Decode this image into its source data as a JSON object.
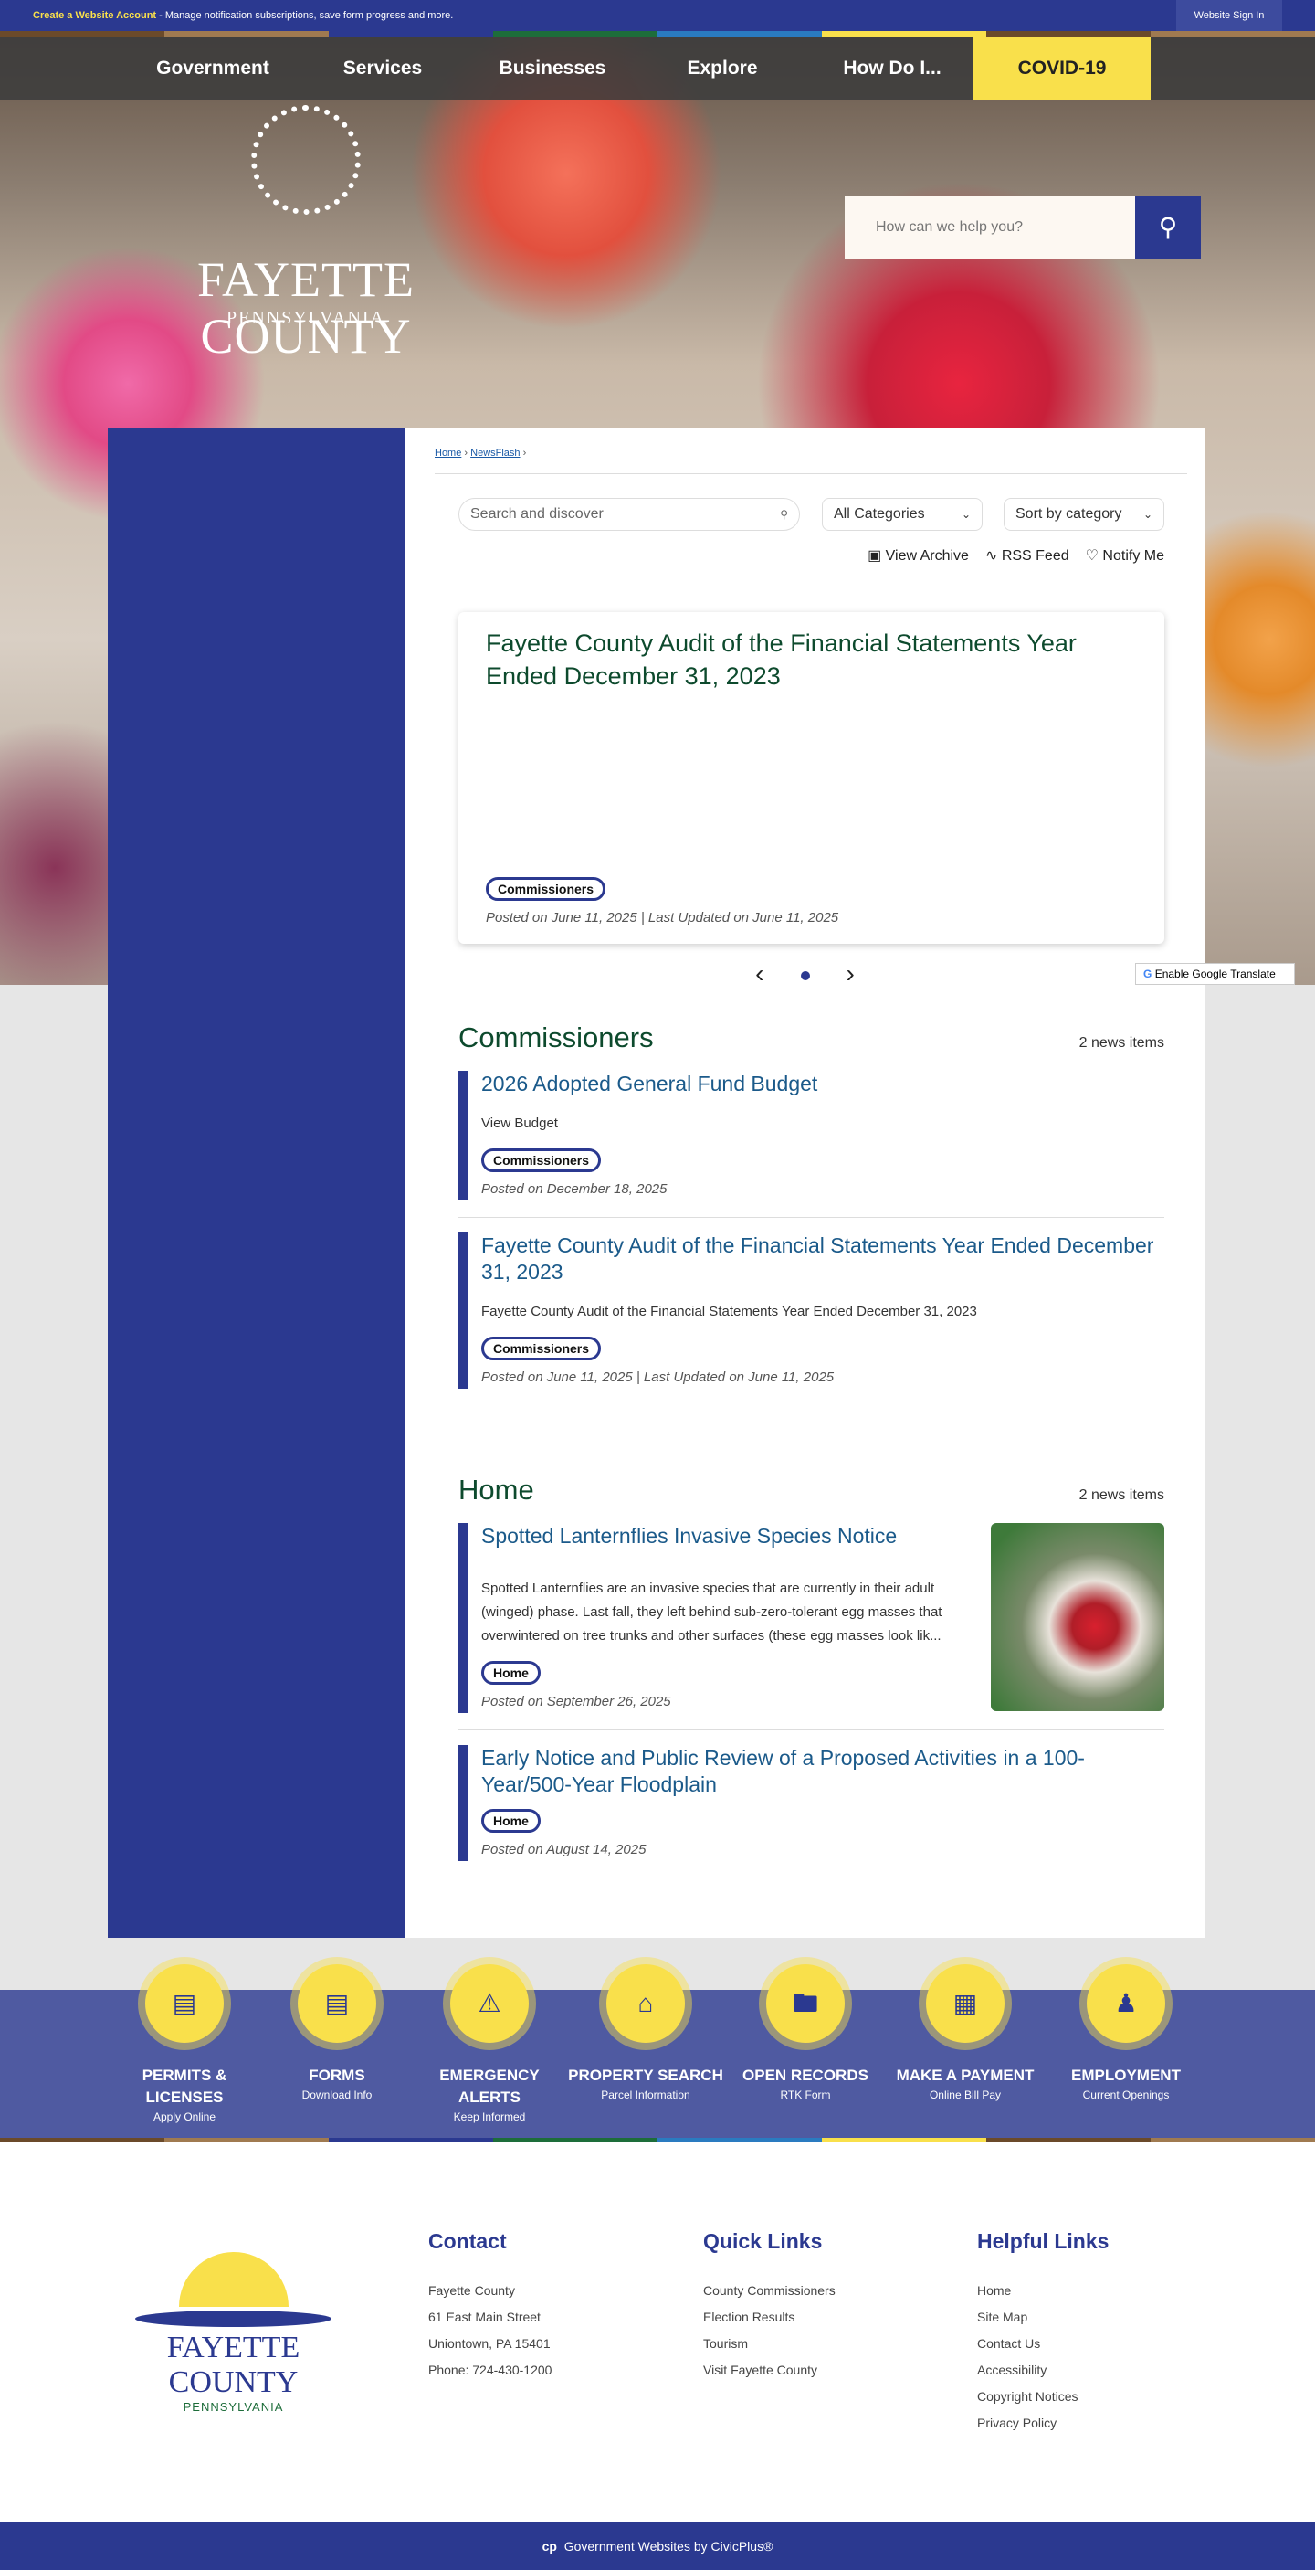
{
  "topbar": {
    "account_link": "Create a Website Account",
    "account_msg": " - Manage notification subscriptions, save form progress and more.",
    "sign_in": "Website Sign In"
  },
  "nav": [
    "Government",
    "Services",
    "Businesses",
    "Explore",
    "How Do I...",
    "COVID-19"
  ],
  "logo": {
    "name": "FAYETTE COUNTY",
    "state": "PENNSYLVANIA"
  },
  "hero_search": {
    "placeholder": "How can we help you?"
  },
  "breadcrumb": {
    "home": "Home",
    "newsflash": "NewsFlash",
    "sep": "›"
  },
  "filters": {
    "search_placeholder": "Search and discover",
    "categories": "All Categories",
    "sort": "Sort by category"
  },
  "actions": {
    "archive": "View Archive",
    "rss": "RSS Feed",
    "notify": "Notify Me"
  },
  "featured": {
    "title": "Fayette County Audit of the Financial Statements Year Ended December 31, 2023",
    "tag": "Commissioners",
    "posted": "Posted on June 11, 2025 | Last Updated on June 11, 2025"
  },
  "translate": "Enable Google Translate",
  "sections": [
    {
      "title": "Commissioners",
      "count": "2 news items",
      "items": [
        {
          "title": "2026 Adopted General Fund Budget",
          "summary": "View Budget",
          "tag": "Commissioners",
          "posted": "Posted on December 18, 2025"
        },
        {
          "title": "Fayette County Audit of the Financial Statements Year Ended December 31, 2023",
          "summary": "Fayette County Audit of the Financial Statements Year Ended December 31, 2023",
          "tag": "Commissioners",
          "posted": "Posted on June 11, 2025 | Last Updated on June 11, 2025"
        }
      ]
    },
    {
      "title": "Home",
      "count": "2 news items",
      "items": [
        {
          "title": "Spotted Lanternflies Invasive Species Notice",
          "summary": "Spotted Lanternflies are an invasive species that are currently in their adult (winged) phase. Last fall, they left behind sub-zero-tolerant egg masses that overwintered on tree trunks and other surfaces (these egg masses look lik...",
          "tag": "Home",
          "posted": "Posted on September 26, 2025"
        },
        {
          "title": "Early Notice and Public Review of a Proposed Activities in a 100-Year/500-Year Floodplain",
          "tag": "Home",
          "posted": "Posted on August 14, 2025"
        }
      ]
    }
  ],
  "quicklinks": [
    {
      "title": "PERMITS & LICENSES",
      "sub": "Apply Online"
    },
    {
      "title": "FORMS",
      "sub": "Download Info"
    },
    {
      "title": "EMERGENCY ALERTS",
      "sub": "Keep Informed"
    },
    {
      "title": "PROPERTY SEARCH",
      "sub": "Parcel Information"
    },
    {
      "title": "OPEN RECORDS",
      "sub": "RTK Form"
    },
    {
      "title": "MAKE A PAYMENT",
      "sub": "Online Bill Pay"
    },
    {
      "title": "EMPLOYMENT",
      "sub": "Current Openings"
    }
  ],
  "footer": {
    "contact": {
      "title": "Contact",
      "lines": [
        "Fayette County",
        "61 East Main Street",
        "Uniontown, PA 15401",
        "Phone: 724-430-1200"
      ]
    },
    "quick": {
      "title": "Quick Links",
      "links": [
        "County Commissioners",
        "Election Results",
        "Tourism",
        "Visit Fayette County"
      ]
    },
    "helpful": {
      "title": "Helpful Links",
      "links": [
        "Home",
        "Site Map",
        "Contact Us",
        "Accessibility",
        "Copyright Notices",
        "Privacy Policy"
      ]
    },
    "credit": "Government Websites by CivicPlus®"
  },
  "colors": {
    "brand": "#2b3990",
    "accent": "#f9e04b",
    "heading": "#0d4a2d"
  }
}
